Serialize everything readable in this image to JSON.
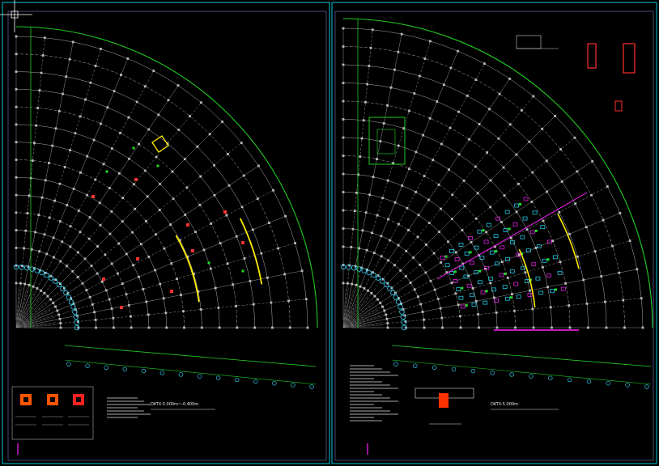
{
  "colors": {
    "background": "#000000",
    "frame": "#00c8d8",
    "boundary_arc": "#22cc22",
    "grid": "#d8d8d8",
    "axis_bubble": "#33c8e8",
    "highlight_wall": "#ffee00",
    "column_marker": "#ff3030",
    "accent_green": "#22dd22",
    "accent_magenta": "#ff22ff",
    "accent_cyan": "#22e0ff"
  },
  "left_sheet": {
    "plan_caption": "DKTX-5.000m~-0.400m"
  },
  "right_sheet": {
    "plan_caption": "DKTX-5.000m"
  }
}
